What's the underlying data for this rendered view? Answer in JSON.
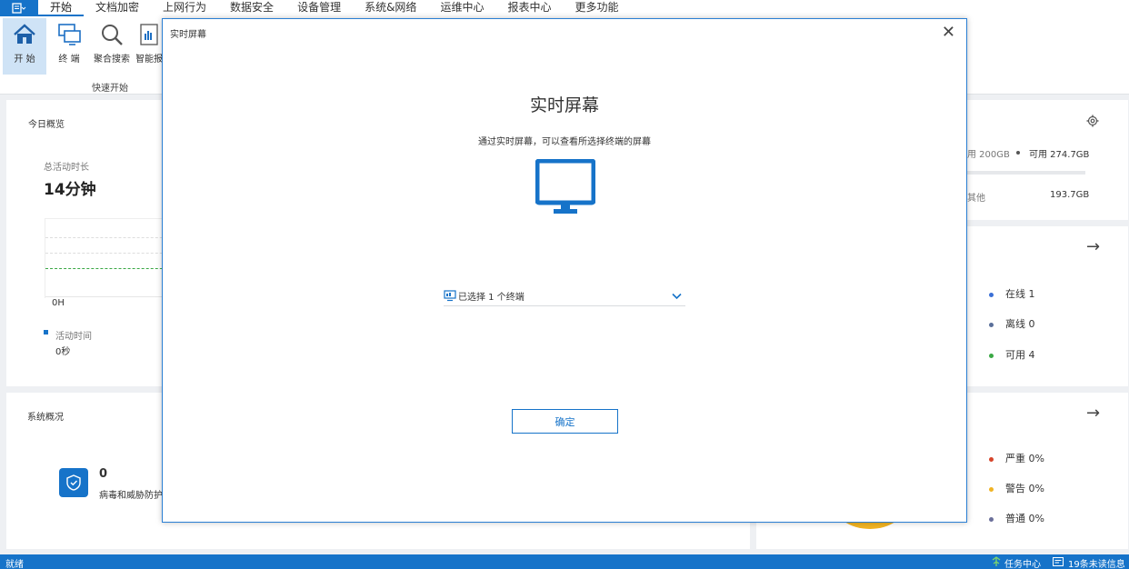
{
  "menu": {
    "tabs": [
      "开始",
      "文档加密",
      "上网行为",
      "数据安全",
      "设备管理",
      "系统&网络",
      "运维中心",
      "报表中心",
      "更多功能"
    ]
  },
  "ribbon": {
    "buttons": [
      "开 始",
      "终 端",
      "聚合搜索",
      "智能报"
    ],
    "group_label": "快速开始"
  },
  "today": {
    "title": "今日概览",
    "active_label": "总活动时长",
    "active_value": "14分钟",
    "axis_tick": "0H",
    "legend_label": "活动时间",
    "legend_value": "0秒"
  },
  "system": {
    "title": "系统概况",
    "virus_count": "0",
    "virus_label": "病毒和威胁防护"
  },
  "disk": {
    "used_text": "用 200GB",
    "available_text": "可用 274.7GB",
    "other_label": "其他",
    "other_value": "193.7GB"
  },
  "terminals": {
    "online": "在线 1",
    "offline": "离线 0",
    "available": "可用 4"
  },
  "alerts": {
    "critical": "严重 0%",
    "warning": "警告 0%",
    "normal": "普通 0%"
  },
  "colors": {
    "accent": "#1673c9",
    "online": "#3b6fd6",
    "offline": "#5a6f9a",
    "available": "#3aa845",
    "critical": "#d6442a",
    "warning": "#f0b323",
    "normal": "#6b6f9a"
  },
  "modal": {
    "title": "实时屏幕",
    "heading": "实时屏幕",
    "description": "通过实时屏幕，可以查看所选择终端的屏幕",
    "select_value": "已选择 1 个终端",
    "confirm_label": "确定"
  },
  "status": {
    "left": "就绪",
    "task_center": "任务中心",
    "unread": "19条未读信息"
  },
  "icons": {
    "app_menu": "app-menu-icon",
    "home": "home-icon",
    "terminal": "terminal-icon",
    "search": "search-icon",
    "report": "report-icon",
    "gear": "gear-icon",
    "arrow": "arrow-right-icon",
    "close": "close-icon",
    "monitor": "monitor-icon",
    "chevron": "chevron-down-icon",
    "shield": "shield-icon"
  }
}
